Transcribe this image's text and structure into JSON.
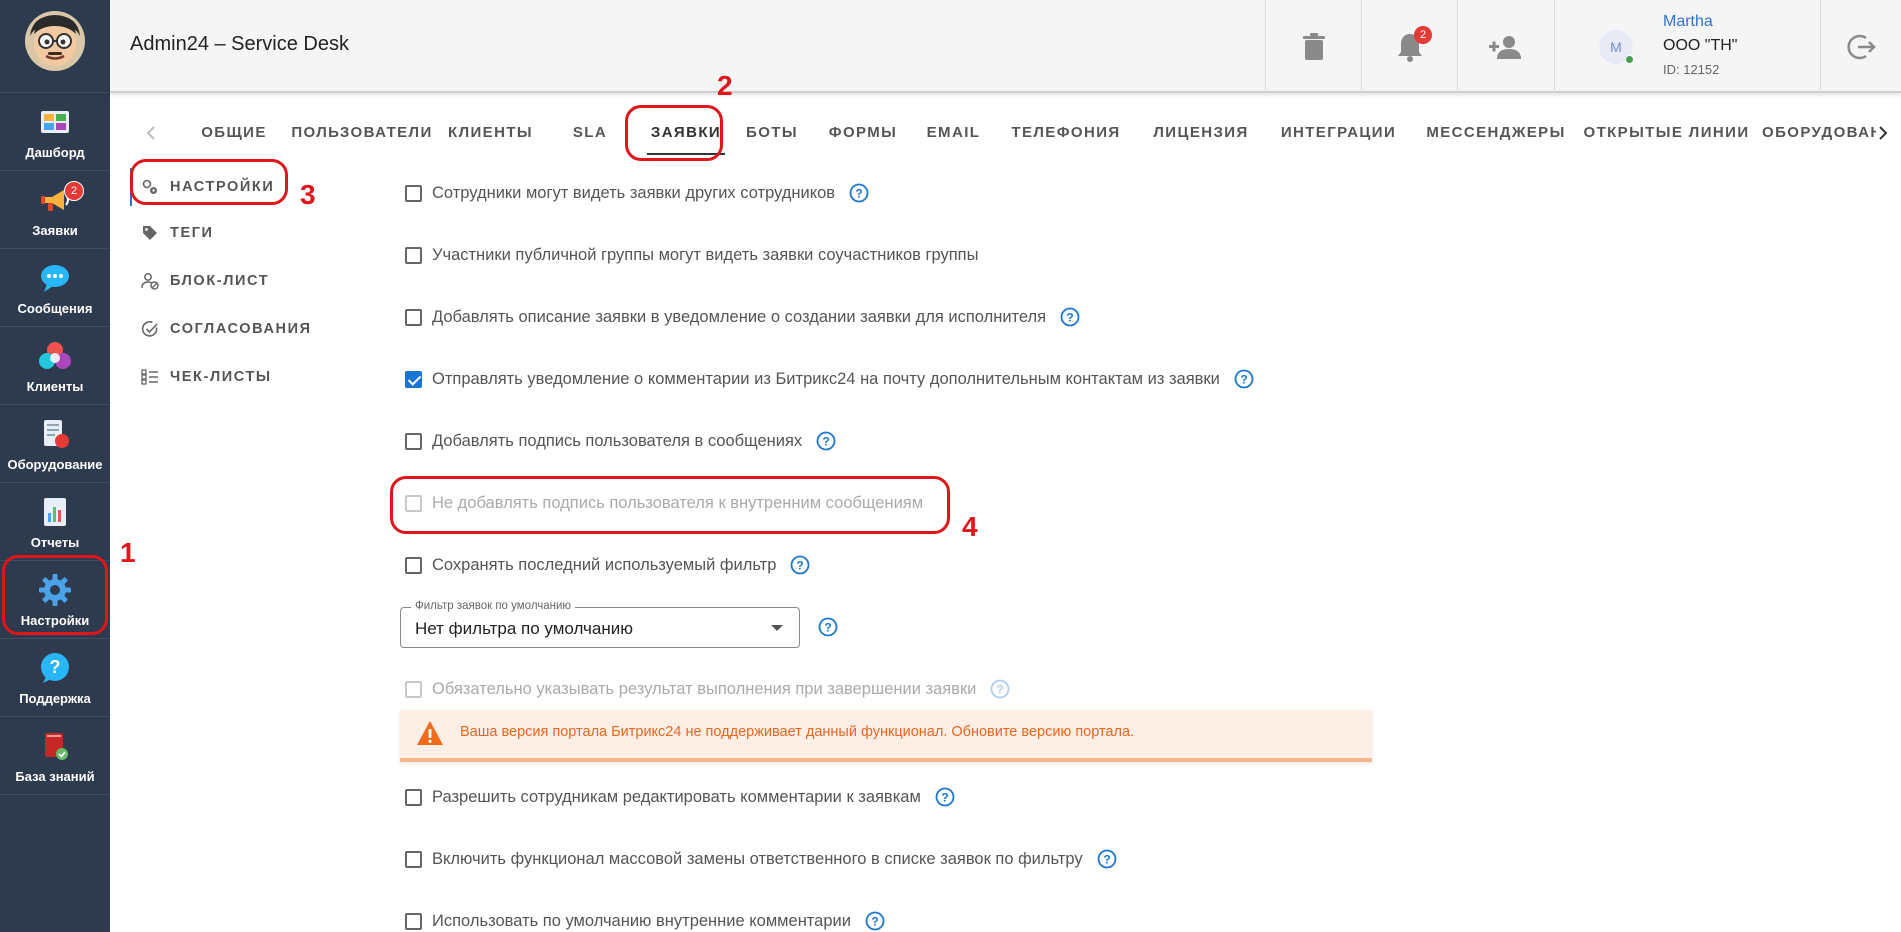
{
  "app": {
    "title": "Admin24 – Service Desk"
  },
  "sidebar": {
    "items": [
      {
        "label": "Дашборд"
      },
      {
        "label": "Заявки",
        "badge": "2"
      },
      {
        "label": "Сообщения"
      },
      {
        "label": "Клиенты"
      },
      {
        "label": "Оборудование"
      },
      {
        "label": "Отчеты"
      },
      {
        "label": "Настройки"
      },
      {
        "label": "Поддержка"
      },
      {
        "label": "База знаний"
      }
    ]
  },
  "header": {
    "notifications_badge": "2",
    "user": {
      "avatar_letter": "M",
      "name": "Martha",
      "org": "ООО \"ТН\"",
      "id_text": "ID: 12152"
    }
  },
  "tabs": [
    {
      "label": "ОБЩИЕ"
    },
    {
      "label": "ПОЛЬЗОВАТЕЛИ"
    },
    {
      "label": "КЛИЕНТЫ"
    },
    {
      "label": "SLA"
    },
    {
      "label": "ЗАЯВКИ",
      "active": true
    },
    {
      "label": "БОТЫ"
    },
    {
      "label": "ФОРМЫ"
    },
    {
      "label": "EMAIL"
    },
    {
      "label": "ТЕЛЕФОНИЯ"
    },
    {
      "label": "ЛИЦЕНЗИЯ"
    },
    {
      "label": "ИНТЕГРАЦИИ"
    },
    {
      "label": "МЕССЕНДЖЕРЫ"
    },
    {
      "label": "ОТКРЫТЫЕ ЛИНИИ"
    },
    {
      "label": "ОБОРУДОВАН"
    }
  ],
  "subnav": [
    {
      "label": "НАСТРОЙКИ",
      "active": true
    },
    {
      "label": "ТЕГИ"
    },
    {
      "label": "БЛОК-ЛИСТ"
    },
    {
      "label": "СОГЛАСОВАНИЯ"
    },
    {
      "label": "ЧЕК-ЛИСТЫ"
    }
  ],
  "settings": {
    "options": [
      {
        "label": "Сотрудники могут видеть заявки других сотрудников",
        "checked": false,
        "help": true
      },
      {
        "label": "Участники публичной группы могут видеть заявки соучастников группы",
        "checked": false,
        "help": false
      },
      {
        "label": "Добавлять описание заявки в уведомление о создании заявки для исполнителя",
        "checked": false,
        "help": true
      },
      {
        "label": "Отправлять уведомление о комментарии из Битрикс24 на почту дополнительным контактам из заявки",
        "checked": true,
        "help": true
      },
      {
        "label": "Добавлять подпись пользователя в сообщениях",
        "checked": false,
        "help": true
      },
      {
        "label": "Не добавлять подпись пользователя к внутренним сообщениям",
        "checked": false,
        "disabled": true,
        "help": false
      },
      {
        "label": "Сохранять последний используемый фильтр",
        "checked": false,
        "help": true
      },
      {
        "label": "Обязательно указывать результат выполнения при завершении заявки",
        "checked": false,
        "disabled": true,
        "help": true
      },
      {
        "label": "Разрешить сотрудникам редактировать комментарии к заявкам",
        "checked": false,
        "help": true
      },
      {
        "label": "Включить функционал массовой замены ответственного в списке заявок по фильтру",
        "checked": false,
        "help": true
      },
      {
        "label": "Использовать по умолчанию внутренние комментарии",
        "checked": false,
        "help": true
      }
    ],
    "default_filter": {
      "legend": "Фильтр заявок по умолчанию",
      "value": "Нет фильтра по умолчанию"
    },
    "alert": "Ваша версия портала Битрикс24 не поддерживает данный функционал. Обновите версию портала."
  },
  "annotations": [
    "1",
    "2",
    "3",
    "4"
  ],
  "colors": {
    "sidebar_bg": "#2e3b4e",
    "accent": "#1976d2",
    "annotation": "#e0161a",
    "alert_text": "#e8681f",
    "alert_bg": "#fdeee6"
  }
}
